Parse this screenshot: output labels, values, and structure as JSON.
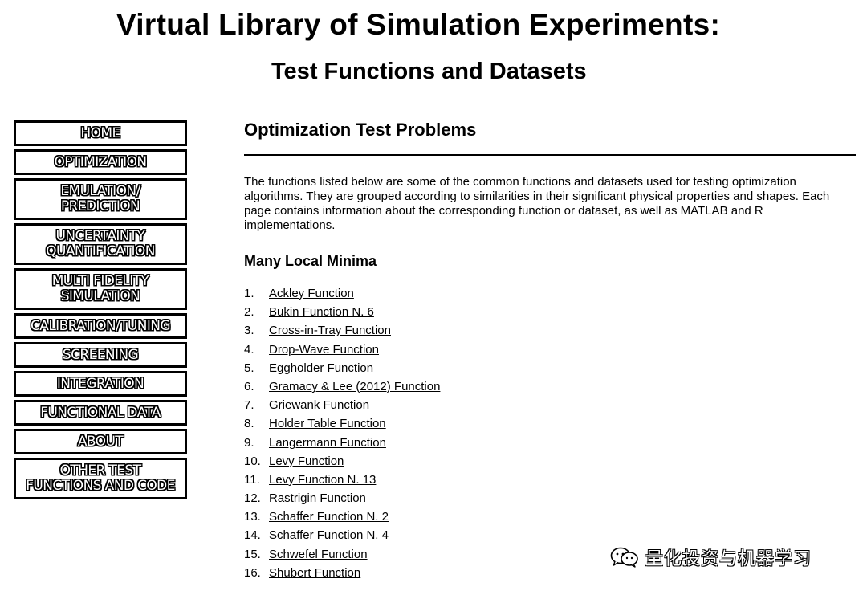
{
  "header": {
    "title": "Virtual Library of Simulation Experiments:",
    "subtitle": "Test Functions and Datasets"
  },
  "sidebar": {
    "items": [
      {
        "label": "HOME"
      },
      {
        "label": "OPTIMIZATION"
      },
      {
        "label": "EMULATION/\nPREDICTION"
      },
      {
        "label": "UNCERTAINTY\nQUANTIFICATION"
      },
      {
        "label": "MULTI FIDELITY\nSIMULATION"
      },
      {
        "label": "CALIBRATION/TUNING"
      },
      {
        "label": "SCREENING"
      },
      {
        "label": "INTEGRATION"
      },
      {
        "label": "FUNCTIONAL DATA"
      },
      {
        "label": "ABOUT"
      },
      {
        "label": "OTHER TEST\nFUNCTIONS AND CODE"
      }
    ]
  },
  "main": {
    "heading": "Optimization Test Problems",
    "intro": "The functions listed below are some of the common functions and datasets used for testing optimization algorithms. They are grouped according to similarities in their significant physical properties and shapes. Each page contains information about the corresponding function or dataset, as well as MATLAB and R implementations.",
    "section_heading": "Many Local Minima",
    "functions": [
      {
        "num": "1.",
        "name": "Ackley Function"
      },
      {
        "num": "2.",
        "name": "Bukin Function N. 6"
      },
      {
        "num": "3.",
        "name": "Cross-in-Tray Function"
      },
      {
        "num": "4.",
        "name": "Drop-Wave Function"
      },
      {
        "num": "5.",
        "name": "Eggholder Function"
      },
      {
        "num": "6.",
        "name": "Gramacy & Lee (2012) Function"
      },
      {
        "num": "7.",
        "name": "Griewank Function"
      },
      {
        "num": "8.",
        "name": "Holder Table Function"
      },
      {
        "num": "9.",
        "name": "Langermann Function"
      },
      {
        "num": "10.",
        "name": "Levy Function"
      },
      {
        "num": "11.",
        "name": "Levy Function N. 13"
      },
      {
        "num": "12.",
        "name": "Rastrigin Function"
      },
      {
        "num": "13.",
        "name": "Schaffer Function N. 2"
      },
      {
        "num": "14.",
        "name": "Schaffer Function N. 4"
      },
      {
        "num": "15.",
        "name": "Schwefel Function"
      },
      {
        "num": "16.",
        "name": "Shubert Function"
      }
    ]
  },
  "watermark": {
    "icon": "wechat-icon",
    "text": "量化投资与机器学习"
  }
}
